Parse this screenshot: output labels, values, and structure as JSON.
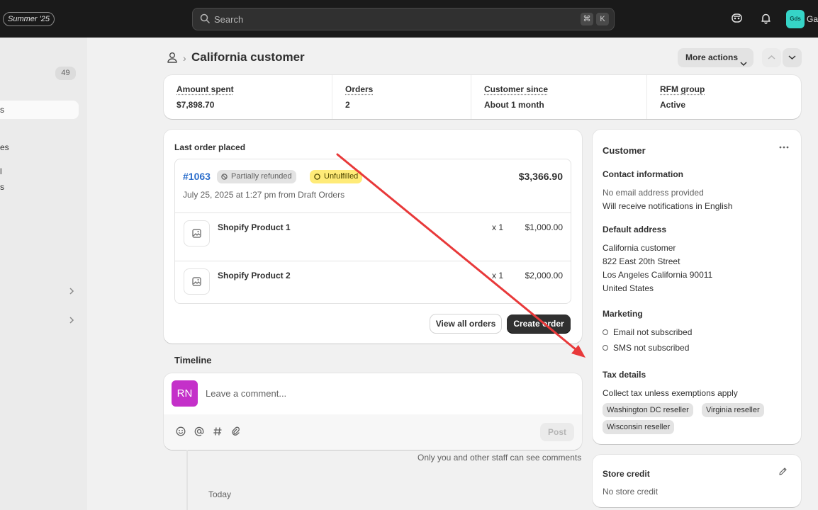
{
  "topbar": {
    "edition_badge": "Summer '25",
    "search_placeholder": "Search",
    "shortcut_key1": "⌘",
    "shortcut_key2": "K",
    "avatar_initials": "Gds",
    "user_name_fragment": "Ga"
  },
  "sidebar": {
    "count_badge": "49",
    "active_item_fragment": "s",
    "item_fragment_1": "es",
    "item_fragment_2": "l",
    "item_fragment_3": "s"
  },
  "header": {
    "title": "California customer",
    "more_actions_label": "More actions"
  },
  "stats": [
    {
      "label": "Amount spent",
      "value": "$7,898.70"
    },
    {
      "label": "Orders",
      "value": "2"
    },
    {
      "label": "Customer since",
      "value": "About 1 month"
    },
    {
      "label": "RFM group",
      "value": "Active"
    }
  ],
  "last_order": {
    "title": "Last order placed",
    "number": "#1063",
    "payment_badge": "Partially refunded",
    "fulfillment_badge": "Unfulfilled",
    "total": "$3,366.90",
    "date_line": "July 25, 2025 at 1:27 pm from Draft Orders",
    "items": [
      {
        "name": "Shopify Product 1",
        "qty": "x 1",
        "price": "$1,000.00"
      },
      {
        "name": "Shopify Product 2",
        "qty": "x 1",
        "price": "$2,000.00"
      }
    ],
    "view_all_label": "View all orders",
    "create_label": "Create order"
  },
  "timeline": {
    "title": "Timeline",
    "avatar_initials": "RN",
    "comment_placeholder": "Leave a comment...",
    "post_label": "Post",
    "staff_note": "Only you and other staff can see comments",
    "today_label": "Today"
  },
  "customer_card": {
    "title": "Customer",
    "contact_title": "Contact information",
    "contact_email": "No email address provided",
    "contact_lang": "Will receive notifications in English",
    "address_title": "Default address",
    "address_lines": [
      "California customer",
      "822 East 20th Street",
      "Los Angeles California 90011",
      "United States"
    ],
    "marketing_title": "Marketing",
    "email_marketing": "Email not subscribed",
    "sms_marketing": "SMS not subscribed",
    "tax_title": "Tax details",
    "tax_line": "Collect tax unless exemptions apply",
    "tax_tags": [
      "Washington DC reseller",
      "Virginia reseller",
      "Wisconsin reseller"
    ]
  },
  "store_credit": {
    "title": "Store credit",
    "value": "No store credit"
  },
  "colors": {
    "topbar_bg": "#1a1a1a",
    "page_bg": "#f1f1f1",
    "link_blue": "#2c6ecb",
    "unfulfilled_yellow": "#ffeb78",
    "annotation_red": "#e8393a",
    "avatar_purple": "#c430c9",
    "avatar_teal": "#36d4c7"
  }
}
